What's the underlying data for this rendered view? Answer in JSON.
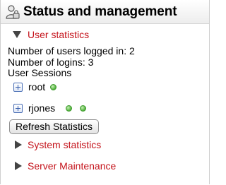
{
  "header": {
    "title": "Status and management",
    "icon": "users-lock-icon"
  },
  "user_statistics": {
    "label": "User statistics",
    "expanded": true,
    "logged_in_line": "Number of users logged in: 2",
    "logins_line": "Number of logins: 3",
    "sessions_heading": "User Sessions",
    "sessions": [
      {
        "user": "root",
        "active_indicators": 1
      },
      {
        "user": "rjones",
        "active_indicators": 2
      }
    ],
    "refresh_label": "Refresh Statistics"
  },
  "system_statistics": {
    "label": "System statistics",
    "expanded": false
  },
  "server_maintenance": {
    "label": "Server Maintenance",
    "expanded": false
  },
  "colors": {
    "section_label": "#c4121a",
    "status_dot": "#4fb03a",
    "expand_box": "#4a6fb5"
  }
}
